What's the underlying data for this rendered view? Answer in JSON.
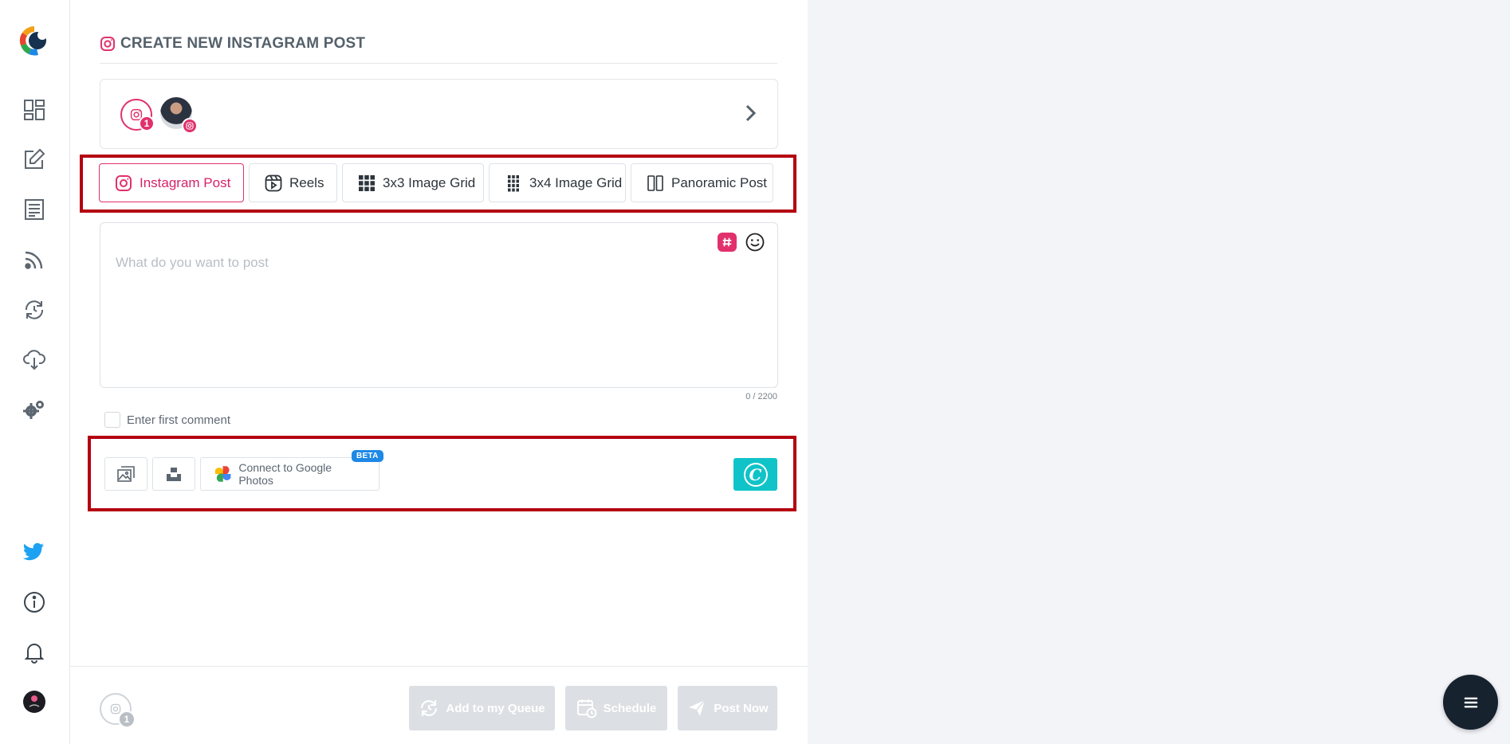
{
  "colors": {
    "instagram": "#e1306c",
    "twitter": "#1da1f2",
    "highlight": "#b40010",
    "canva": "#10c3c8",
    "disabled": "#dcdfe3"
  },
  "sidebar": {
    "items": [
      {
        "name": "dashboard-icon"
      },
      {
        "name": "compose-icon"
      },
      {
        "name": "posts-icon"
      },
      {
        "name": "rss-icon"
      },
      {
        "name": "recycle-icon"
      },
      {
        "name": "cloud-download-icon"
      },
      {
        "name": "settings-icon"
      },
      {
        "name": "twitter-icon"
      },
      {
        "name": "info-icon"
      },
      {
        "name": "bell-icon"
      },
      {
        "name": "avatar"
      }
    ]
  },
  "header": {
    "title": "CREATE NEW INSTAGRAM POST"
  },
  "accounts": {
    "selected_count": "1"
  },
  "tabs": [
    {
      "label": "Instagram Post",
      "icon": "instagram-icon",
      "active": true
    },
    {
      "label": "Reels",
      "icon": "reels-icon",
      "active": false
    },
    {
      "label": "3x3 Image Grid",
      "icon": "grid-3x3-icon",
      "active": false
    },
    {
      "label": "3x4 Image Grid",
      "icon": "grid-3x4-icon",
      "active": false
    },
    {
      "label": "Panoramic Post",
      "icon": "panoramic-icon",
      "active": false
    }
  ],
  "composer": {
    "placeholder": "What do you want to post",
    "value": "",
    "counter": "0 / 2200"
  },
  "first_comment": {
    "label": "Enter first comment",
    "checked": false
  },
  "media": {
    "google_photos_label": "Connect to Google Photos",
    "beta_badge": "BETA",
    "canva_letter": "C"
  },
  "footer": {
    "account_count": "1",
    "add_queue_label": "Add to my Queue",
    "schedule_label": "Schedule",
    "post_now_label": "Post Now"
  }
}
